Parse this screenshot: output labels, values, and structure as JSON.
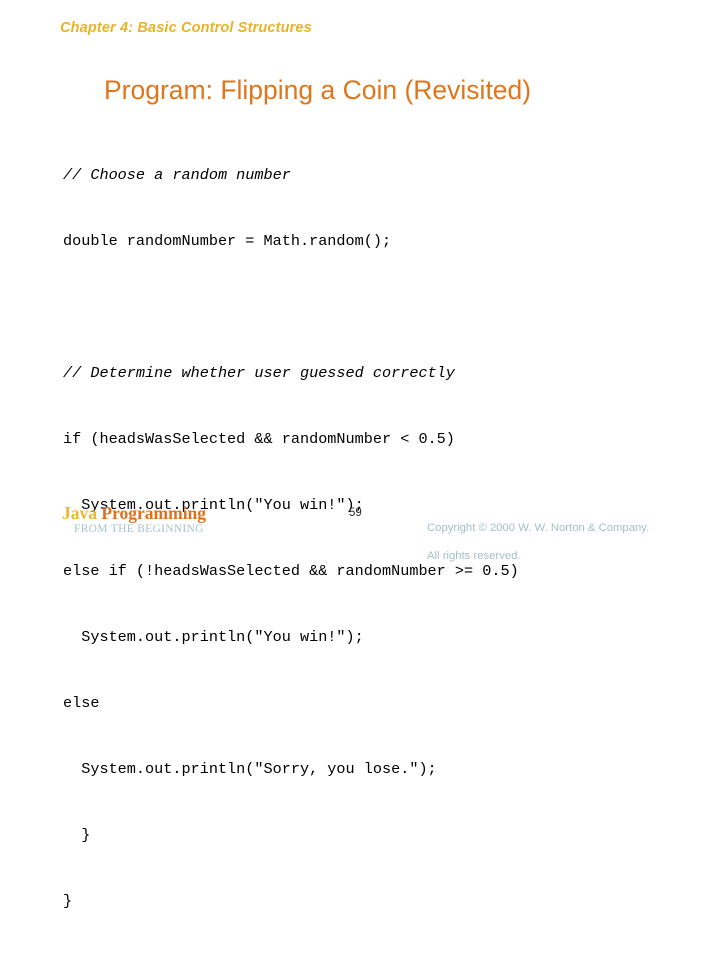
{
  "slide": {
    "chapter_header": "Chapter 4: Basic Control Structures",
    "title": "Program: Flipping a Coin (Revisited)",
    "colors": {
      "chapter_header": "#e7b428",
      "title": "#e0761c",
      "code": "#000000",
      "brand_gold": "#e9b733",
      "brand_orange": "#e2701b",
      "subbrand": "#a6c3c9",
      "copyright": "#a3bfc6",
      "background": "#ffffff"
    }
  },
  "code": {
    "lines": [
      {
        "text": "// Choose a random number",
        "style": "comment"
      },
      {
        "text": "double randomNumber = Math.random();",
        "style": "code"
      },
      {
        "text": "",
        "style": "blank"
      },
      {
        "text": "// Determine whether user guessed correctly",
        "style": "comment"
      },
      {
        "text": "if (headsWasSelected && randomNumber < 0.5)",
        "style": "code"
      },
      {
        "text": "  System.out.println(\"You win!\");",
        "style": "code"
      },
      {
        "text": "else if (!headsWasSelected && randomNumber >= 0.5)",
        "style": "code"
      },
      {
        "text": "  System.out.println(\"You win!\");",
        "style": "code"
      },
      {
        "text": "else",
        "style": "code"
      },
      {
        "text": "  System.out.println(\"Sorry, you lose.\");",
        "style": "code"
      }
    ],
    "closing_braces": [
      {
        "text": "  }",
        "style": "code"
      },
      {
        "text": "}",
        "style": "code"
      }
    ]
  },
  "footer": {
    "brand_part1": "Java ",
    "brand_part2": "Programming",
    "subbrand": "FROM THE BEGINNING",
    "page_number": "59",
    "copyright_line1": "Copyright © 2000 W. W. Norton & Company.",
    "copyright_line2": "All rights reserved."
  }
}
